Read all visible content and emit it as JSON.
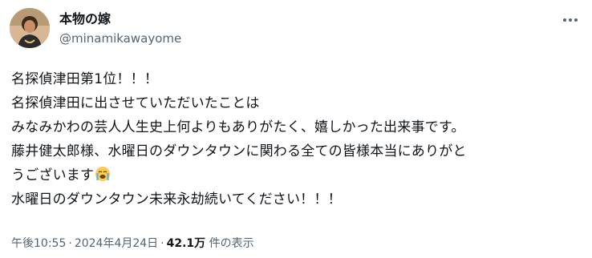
{
  "author": {
    "display_name": "本物の嫁",
    "handle": "@minamikawayome",
    "avatar_icon": "avatar-photo"
  },
  "post": {
    "lines": [
      "名探偵津田第1位！！！",
      "名探偵津田に出させていただいたことは",
      "みなみかわの芸人人生史上何よりもありがたく、嬉しかった出来事です。",
      "藤井健太郎様、水曜日のダウンタウンに関わる全ての皆様本当にありがと",
      "うございます",
      "水曜日のダウンタウン未来永劫続いてください！！！"
    ],
    "emoji": "loudly-crying-face"
  },
  "meta": {
    "time": "午後10:55",
    "separator": "·",
    "date": "2024年4月24日",
    "views_count": "42.1万",
    "views_label": " 件の表示"
  },
  "more_icon": "more-horizontal-icon"
}
